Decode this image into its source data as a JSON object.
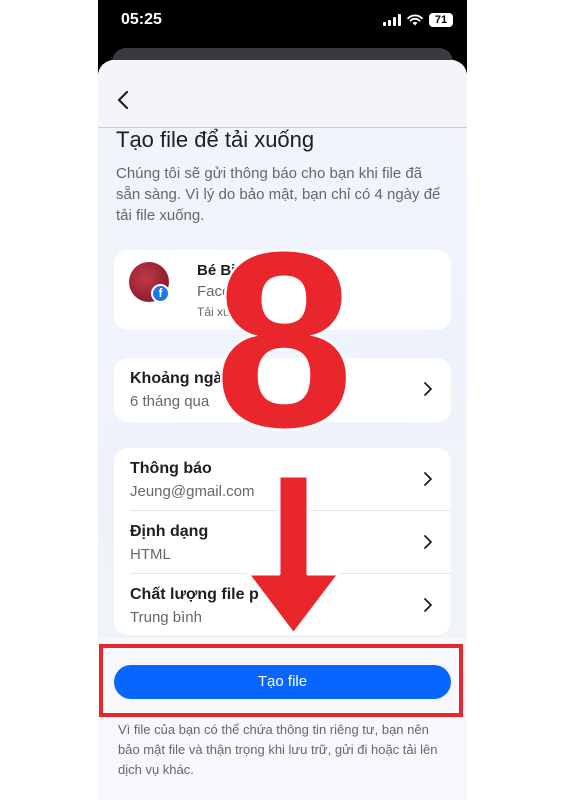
{
  "status_bar": {
    "time": "05:25",
    "battery": "71"
  },
  "header": {
    "back_icon": "chevron-left-icon"
  },
  "main": {
    "title": "Tạo file để tải xuống",
    "description": "Chúng tôi sẽ gửi thông báo cho bạn khi file đã sẵn sàng. Vì lý do bảo mật, bạn chỉ có 4 ngày để tải file xuống.",
    "profile": {
      "name": "Bé Bi",
      "platform": "Faceb",
      "note": "Tải xuố      ần"
    },
    "date_range": {
      "label": "Khoảng ngà",
      "value": "6 tháng qua"
    },
    "settings": [
      {
        "label": "Thông báo",
        "value": "Jeung@gmail.com"
      },
      {
        "label": "Định dạng",
        "value": "HTML"
      },
      {
        "label": "Chất lượng file p          ện",
        "value": "Trung bình"
      }
    ],
    "create_button": "Tạo file",
    "footer_note": "Vì file của bạn có thể chứa thông tin riêng tư, bạn nên bảo mật file và thận trọng khi lưu trữ, gửi đi hoặc tải lên dịch vụ khác."
  },
  "annotation": {
    "step_number": "8",
    "color": "#e8262b"
  },
  "colors": {
    "accent": "#0866ff",
    "facebook": "#1877f2",
    "annotation": "#e8262b"
  }
}
